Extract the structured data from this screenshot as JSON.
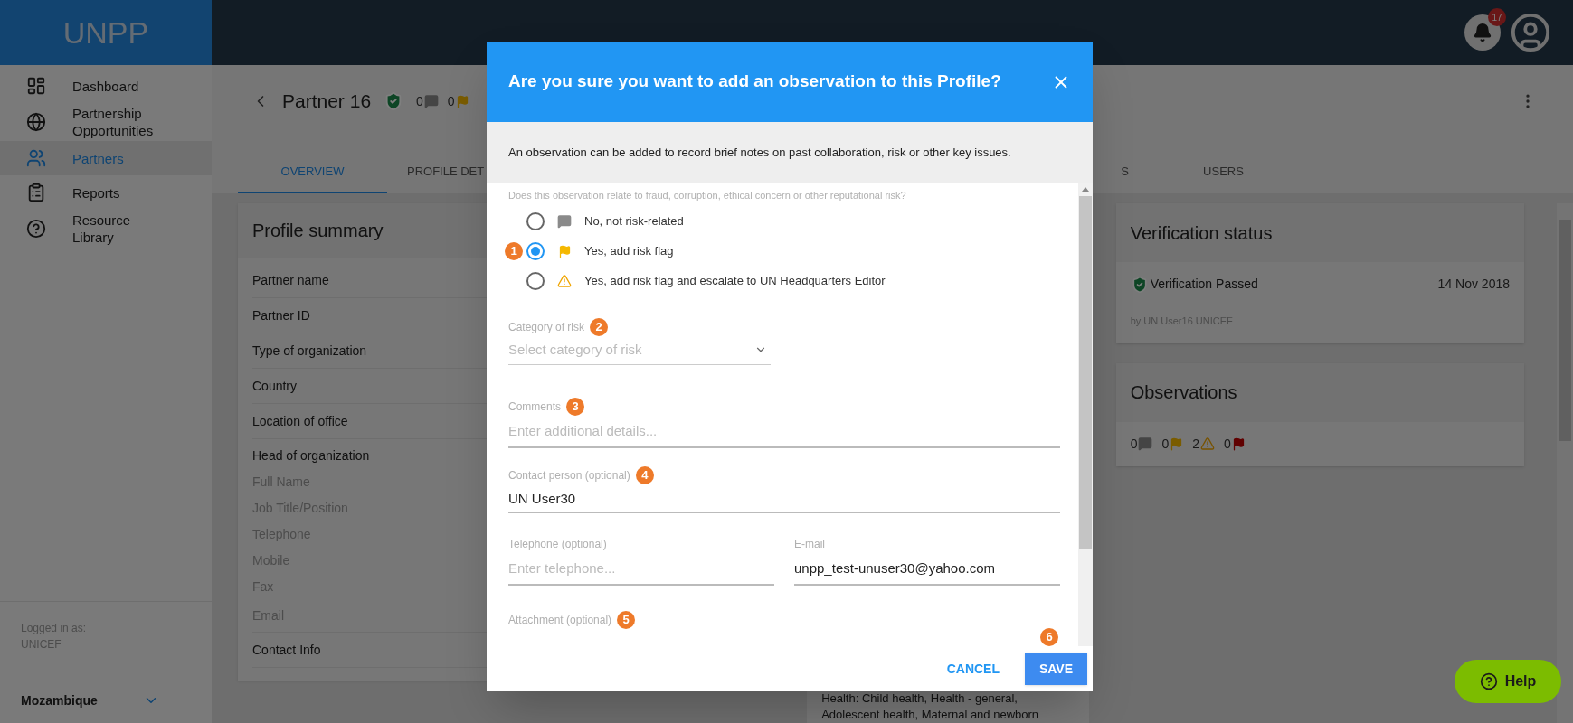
{
  "app": {
    "logo": "UNPP",
    "notification_count": "17"
  },
  "sidebar": {
    "items": [
      {
        "label": "Dashboard",
        "selected": false
      },
      {
        "label": "Partnership Opportunities",
        "selected": false
      },
      {
        "label": "Partners",
        "selected": true
      },
      {
        "label": "Reports",
        "selected": false
      },
      {
        "label": "Resource Library",
        "selected": false
      }
    ],
    "logged_in_label": "Logged in as:",
    "logged_in_org": "UNICEF",
    "country": "Mozambique"
  },
  "partner": {
    "title": "Partner 16",
    "counts": [
      {
        "value": "0",
        "kind": "comment"
      },
      {
        "value": "0",
        "kind": "flag"
      }
    ]
  },
  "tabs": [
    {
      "label": "OVERVIEW",
      "selected": true
    },
    {
      "label": "PROFILE DET",
      "selected": false
    },
    {
      "label": "S",
      "selected": false
    },
    {
      "label": "USERS",
      "selected": false
    }
  ],
  "profile_summary": {
    "title": "Profile summary",
    "rows": [
      {
        "label": "Partner name",
        "kind": "field"
      },
      {
        "label": "Partner ID",
        "kind": "field"
      },
      {
        "label": "Type of organization",
        "kind": "field"
      },
      {
        "label": "Country",
        "kind": "field"
      },
      {
        "label": "Location of office",
        "kind": "field"
      },
      {
        "label": "Head of organization",
        "kind": "group"
      },
      {
        "label": "Full Name",
        "kind": "sub"
      },
      {
        "label": "Job Title/Position",
        "kind": "sub"
      },
      {
        "label": "Telephone",
        "kind": "sub"
      },
      {
        "label": "Mobile",
        "kind": "sub"
      },
      {
        "label": "Fax",
        "kind": "sub"
      },
      {
        "label": "Email",
        "kind": "sub_last"
      },
      {
        "label": "Contact Info",
        "kind": "field"
      }
    ]
  },
  "sectors_text": [
    "Health: Child health, Health - general,",
    "Adolescent health, Maternal and newborn"
  ],
  "verification": {
    "title": "Verification status",
    "status": "Verification Passed",
    "date": "14 Nov 2018",
    "by": "by UN User16 UNICEF"
  },
  "observations": {
    "title": "Observations",
    "counts": [
      {
        "value": "0",
        "kind": "comment"
      },
      {
        "value": "0",
        "kind": "flag"
      },
      {
        "value": "2",
        "kind": "warning"
      },
      {
        "value": "0",
        "kind": "red_flag"
      }
    ]
  },
  "help_button": "Help",
  "dialog": {
    "title": "Are you sure you want to add an observation to this Profile?",
    "intro": "An observation can be added to record brief notes on past collaboration, risk or other key issues.",
    "question": "Does this observation relate to fraud, corruption, ethical concern or other reputational risk?",
    "options": [
      {
        "label": "No, not risk-related",
        "kind": "comment",
        "selected": false
      },
      {
        "label": "Yes, add risk flag",
        "kind": "flag",
        "selected": true,
        "marker": "1"
      },
      {
        "label": "Yes, add risk flag and escalate to UN Headquarters Editor",
        "kind": "warning",
        "selected": false
      }
    ],
    "category": {
      "label": "Category of risk",
      "placeholder": "Select category of risk",
      "marker": "2"
    },
    "comments": {
      "label": "Comments",
      "placeholder": "Enter additional details...",
      "marker": "3"
    },
    "contact": {
      "label": "Contact person (optional)",
      "value": "UN User30",
      "marker": "4"
    },
    "telephone": {
      "label": "Telephone (optional)",
      "placeholder": "Enter telephone..."
    },
    "email": {
      "label": "E-mail",
      "value": "unpp_test-unuser30@yahoo.com"
    },
    "attachment": {
      "label": "Attachment (optional)",
      "marker": "5"
    },
    "cancel": "CANCEL",
    "save": {
      "label": "SAVE",
      "marker": "6"
    }
  }
}
